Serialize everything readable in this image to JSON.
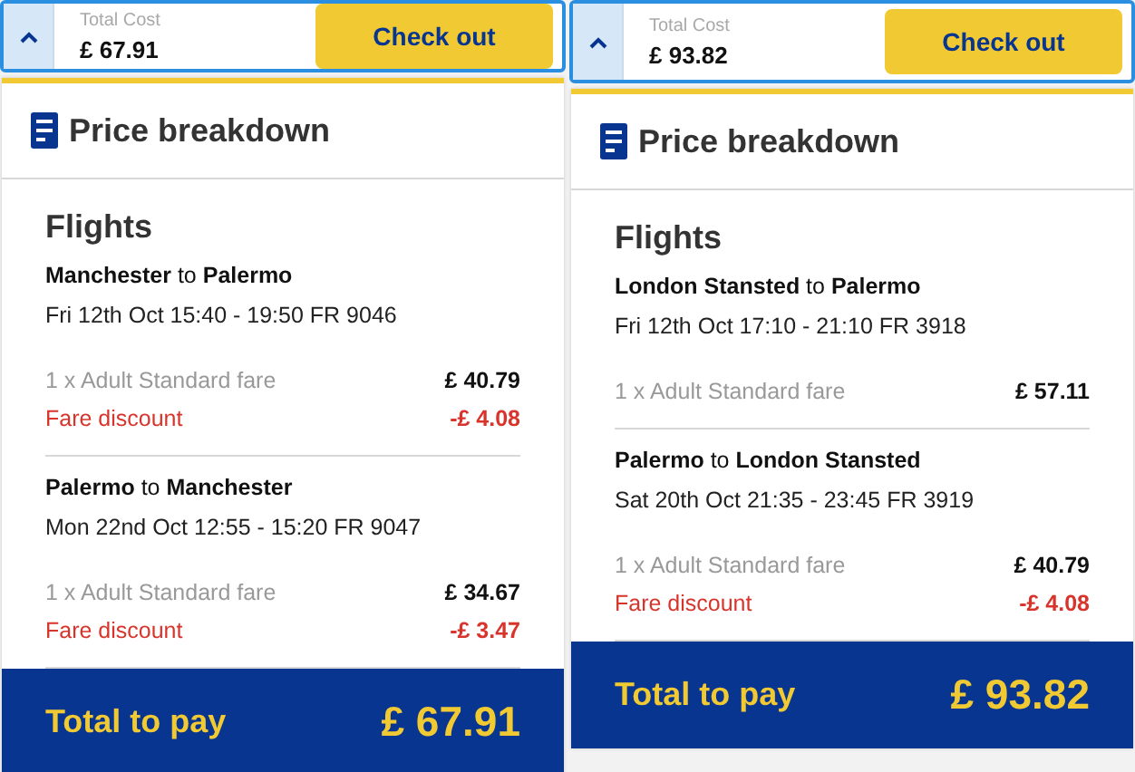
{
  "panels": [
    {
      "header": {
        "label": "Total Cost",
        "amount": "£ 67.91",
        "button": "Check out"
      },
      "title": "Price breakdown",
      "section": "Flights",
      "flights": [
        {
          "route": "**Manchester** to **Palermo**",
          "schedule": "Fri 12th Oct 15:40 - 19:50 FR 9046",
          "lines": [
            {
              "kind": "fare",
              "label": "1 x Adult Standard fare",
              "amount": "£ 40.79"
            },
            {
              "kind": "discount",
              "label": "Fare discount",
              "amount": "-£ 4.08"
            }
          ]
        },
        {
          "route": "**Palermo** to **Manchester**",
          "schedule": "Mon 22nd Oct 12:55 - 15:20 FR 9047",
          "lines": [
            {
              "kind": "fare",
              "label": "1 x Adult Standard fare",
              "amount": "£ 34.67"
            },
            {
              "kind": "discount",
              "label": "Fare discount",
              "amount": "-£ 3.47"
            }
          ]
        }
      ],
      "total": {
        "label": "Total to pay",
        "amount": "£ 67.91"
      }
    },
    {
      "header": {
        "label": "Total Cost",
        "amount": "£ 93.82",
        "button": "Check out"
      },
      "title": "Price breakdown",
      "section": "Flights",
      "flights": [
        {
          "route": "**London Stansted** to **Palermo**",
          "schedule": "Fri 12th Oct 17:10 - 21:10 FR 3918",
          "lines": [
            {
              "kind": "fare",
              "label": "1 x Adult Standard fare",
              "amount": "£ 57.11"
            }
          ]
        },
        {
          "route": "**Palermo** to **London Stansted**",
          "schedule": "Sat 20th Oct 21:35 - 23:45 FR 3919",
          "lines": [
            {
              "kind": "fare",
              "label": "1 x Adult Standard fare",
              "amount": "£ 40.79"
            },
            {
              "kind": "discount",
              "label": "Fare discount",
              "amount": "-£ 4.08"
            }
          ]
        }
      ],
      "total": {
        "label": "Total to pay",
        "amount": "£ 93.82"
      }
    }
  ]
}
